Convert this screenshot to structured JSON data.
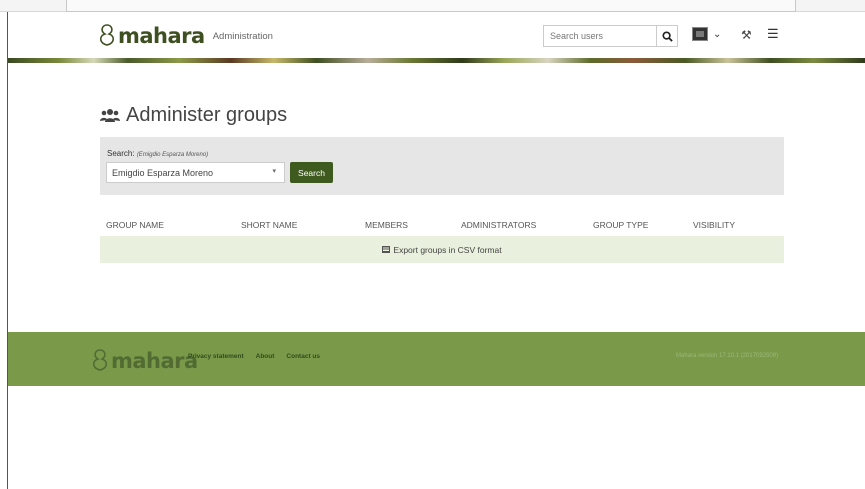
{
  "header": {
    "brand": "mahara",
    "subtitle": "Administration",
    "search_placeholder": "Search users",
    "search_icon": "search-icon",
    "menu_icon": "hamburger-menu-icon",
    "admin_icon": "wrench-icon"
  },
  "page": {
    "title": "Administer groups",
    "title_icon": "users-icon"
  },
  "search": {
    "label": "Search:",
    "hint": "(Emigdio Esparza Moreno)",
    "selected_value": "Emigdio Esparza Moreno",
    "button_label": "Search"
  },
  "table": {
    "columns": [
      "GROUP NAME",
      "SHORT NAME",
      "MEMBERS",
      "ADMINISTRATORS",
      "GROUP TYPE",
      "VISIBILITY"
    ],
    "export_label": "Export groups in CSV format"
  },
  "footer": {
    "brand": "mahara",
    "links": [
      "Privacy statement",
      "About",
      "Contact us"
    ],
    "version": "Mahara version 17.10.1 (2017092509)"
  },
  "colors": {
    "brand_green": "#3e4f21",
    "footer_green": "#7a9a4a",
    "button_green": "#3e5a1f",
    "export_row_bg": "#e9f0dd"
  }
}
